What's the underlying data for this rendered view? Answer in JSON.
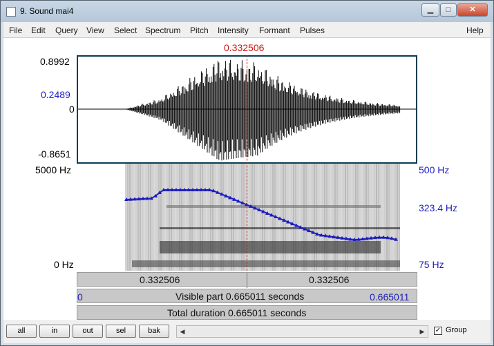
{
  "window": {
    "title": "9. Sound mai4",
    "minimize_icon": "minimize-icon",
    "maximize_icon": "maximize-icon",
    "close_icon": "close-icon"
  },
  "menu": [
    "File",
    "Edit",
    "Query",
    "View",
    "Select",
    "Spectrum",
    "Pitch",
    "Intensity",
    "Formant",
    "Pulses",
    "Help"
  ],
  "waveform": {
    "cursor_time": "0.332506",
    "y_max": "0.8992",
    "y_mid_blue": "0.2489",
    "y_zero": "0",
    "y_min": "-0.8651"
  },
  "spectrogram": {
    "freq_top": "5000 Hz",
    "freq_bottom": "0 Hz",
    "pitch_top": "500 Hz",
    "pitch_mid": "323.4 Hz",
    "pitch_bottom": "75 Hz"
  },
  "time_bars": {
    "left_segment": "0.332506",
    "right_segment": "0.332506",
    "visible_start": "0",
    "visible_label": "Visible part 0.665011 seconds",
    "visible_end": "0.665011",
    "total_label": "Total duration 0.665011 seconds"
  },
  "bottom": {
    "buttons": [
      "all",
      "in",
      "out",
      "sel",
      "bak"
    ],
    "group_label": "Group",
    "group_checked": true
  },
  "colors": {
    "pitch_line": "#1d1dbf",
    "cursor": "#d01010"
  }
}
